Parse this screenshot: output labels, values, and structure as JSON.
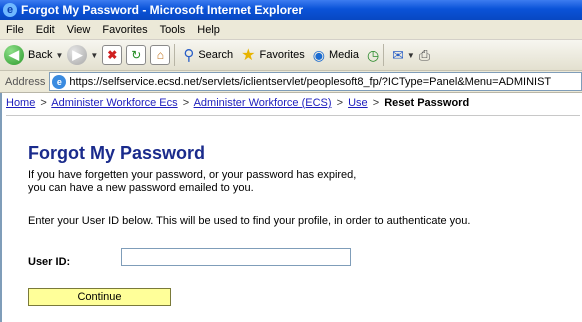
{
  "window": {
    "title": "Forgot My Password - Microsoft Internet Explorer"
  },
  "menu": {
    "items": [
      "File",
      "Edit",
      "View",
      "Favorites",
      "Tools",
      "Help"
    ]
  },
  "toolbar": {
    "back_label": "Back",
    "search_label": "Search",
    "favorites_label": "Favorites",
    "media_label": "Media"
  },
  "addressbar": {
    "label": "Address",
    "url": "https://selfservice.ecsd.net/servlets/iclientservlet/peoplesoft8_fp/?ICType=Panel&Menu=ADMINIST"
  },
  "breadcrumb": {
    "home": "Home",
    "item1": "Administer Workforce Ecs",
    "item2": "Administer Workforce (ECS)",
    "item3": "Use",
    "current": "Reset Password",
    "sep": ">"
  },
  "page": {
    "title": "Forgot My Password",
    "intro_line1": "If you have forgetten your password, or your password has expired,",
    "intro_line2": "you can have a new password emailed to you.",
    "instruction": "Enter your User ID below. This will be used to find your profile, in order to authenticate you.",
    "userid_label": "User ID:",
    "userid_value": "",
    "continue_label": "Continue"
  },
  "colors": {
    "title_blue": "#1a2b8c",
    "link_blue": "#1d1dbd",
    "button_yellow": "#ffff99",
    "titlebar_blue": "#0a53d8"
  }
}
